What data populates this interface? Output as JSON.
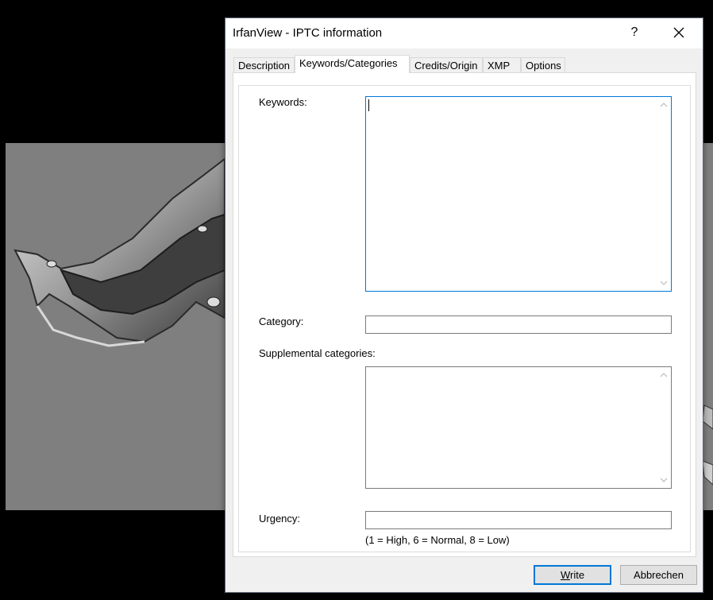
{
  "window": {
    "title": "IrfanView - IPTC information",
    "help_label": "?"
  },
  "tabs": [
    {
      "label": "Description"
    },
    {
      "label": "Keywords/Categories"
    },
    {
      "label": "Credits/Origin"
    },
    {
      "label": "XMP"
    },
    {
      "label": "Options"
    }
  ],
  "form": {
    "keywords_label": "Keywords:",
    "keywords_value": "",
    "category_label": "Category:",
    "category_value": "",
    "supplemental_label": "Supplemental categories:",
    "supplemental_value": "",
    "urgency_label": "Urgency:",
    "urgency_value": "",
    "urgency_hint": "(1 = High, 6 = Normal, 8 = Low)"
  },
  "buttons": {
    "write_label": "Write",
    "cancel_label": "Abbrechen"
  },
  "colors": {
    "accent": "#0078d7",
    "backdrop": "#7f7f7f"
  },
  "icons": {
    "close": "close-icon",
    "scroll_up": "chevron-up-icon",
    "scroll_down": "chevron-down-icon"
  }
}
